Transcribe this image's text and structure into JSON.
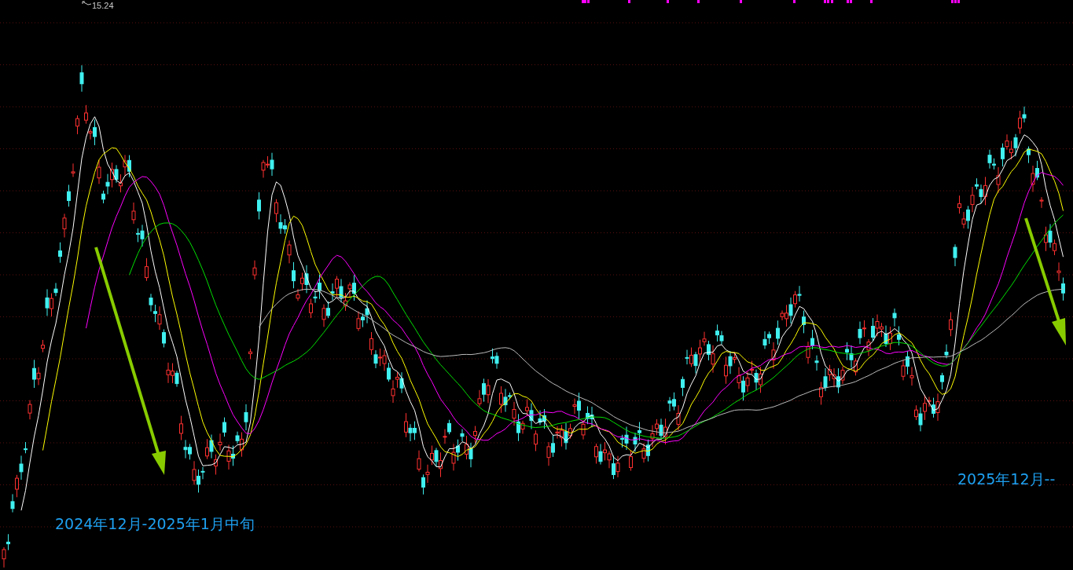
{
  "chart": {
    "peak_label": "15.24",
    "annotations": [
      {
        "text": "2024年12月-2025年1月中旬"
      },
      {
        "text": "2025年12月--"
      }
    ]
  }
}
